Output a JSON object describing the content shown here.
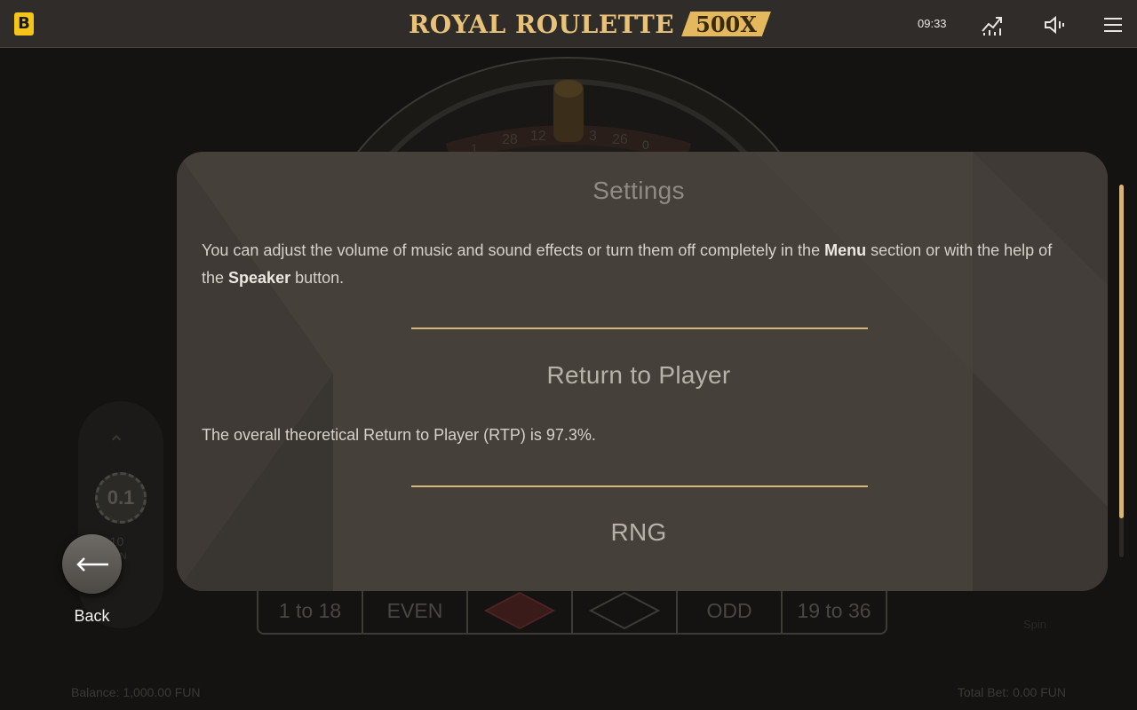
{
  "header": {
    "brand_letter": "B",
    "title": "ROYAL ROULETTE",
    "multiplier": "500X",
    "clock": "09:33",
    "icons": [
      "stats-icon",
      "speaker-icon",
      "menu-icon"
    ]
  },
  "background": {
    "wheel_numbers": [
      "1",
      "28",
      "12",
      "3",
      "26",
      "0"
    ],
    "board": [
      "1 to 18",
      "EVEN",
      "",
      "",
      "ODD",
      "19 to 36"
    ],
    "chip": {
      "value": "0.1",
      "amount": "0.10",
      "unit": "FUN"
    },
    "balance": "Balance: 1,000.00 FUN",
    "total_bet": "Total Bet: 0.00 FUN",
    "spin_label": "Spin"
  },
  "modal": {
    "settings_title": "Settings",
    "settings_text_1": "You can adjust the volume of music and sound effects or turn them off completely in the ",
    "settings_bold_1": "Menu",
    "settings_text_2": " section or with the help of the ",
    "settings_bold_2": "Speaker",
    "settings_text_3": " button.",
    "rtp_title": "Return to Player",
    "rtp_text": "The overall theoretical Return to Player (RTP) is 97.3%.",
    "rng_title": "RNG"
  },
  "back": {
    "label": "Back"
  },
  "colors": {
    "accent_gold": "#d8b477",
    "brand_yellow": "#f5c518",
    "modal_bg": "#3f3b36"
  }
}
